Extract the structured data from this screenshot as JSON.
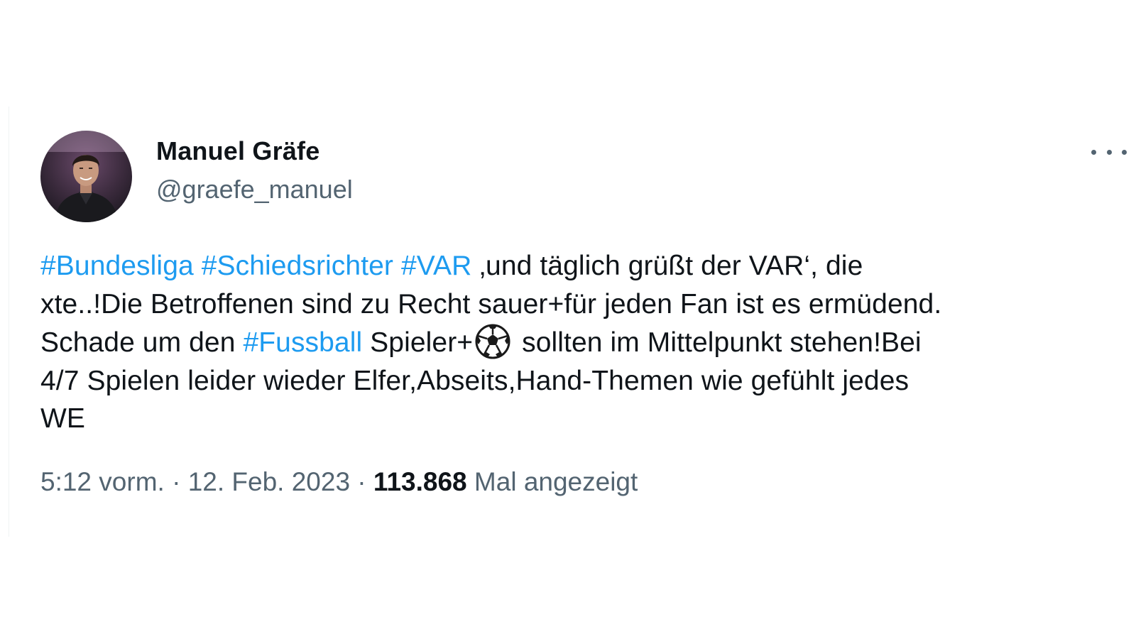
{
  "tweet": {
    "author": {
      "display_name": "Manuel Gräfe",
      "handle": "@graefe_manuel",
      "avatar_icon": "profile-photo"
    },
    "more_icon": "more-options-icon",
    "text_lines": [
      {
        "hashtags": [
          "#Bundesliga",
          "#Schiedsrichter",
          "#VAR"
        ],
        "text": " ‚und täglich grüßt der VAR‘, die"
      },
      {
        "text": "xte..!Die Betroffenen sind zu Recht sauer+für jeden Fan ist es ermüdend."
      },
      {
        "before": "Schade um den ",
        "hashtag": "#Fussball",
        "middle": " Spieler+",
        "emoji": "soccer-ball-icon",
        "after": " sollten im Mittelpunkt stehen!Bei"
      },
      {
        "text": "4/7 Spielen leider wieder Elfer,Abseits,Hand-Themen wie gefühlt jedes"
      },
      {
        "text": "WE"
      }
    ],
    "meta": {
      "time": "5:12 vorm.",
      "separator_1": " · ",
      "date": "12. Feb. 2023",
      "separator_2": " · ",
      "views_count": "113.868",
      "views_label": " Mal angezeigt"
    }
  },
  "colors": {
    "text": "#0f1419",
    "secondary": "#536471",
    "link": "#1d9bf0",
    "background": "#ffffff"
  }
}
